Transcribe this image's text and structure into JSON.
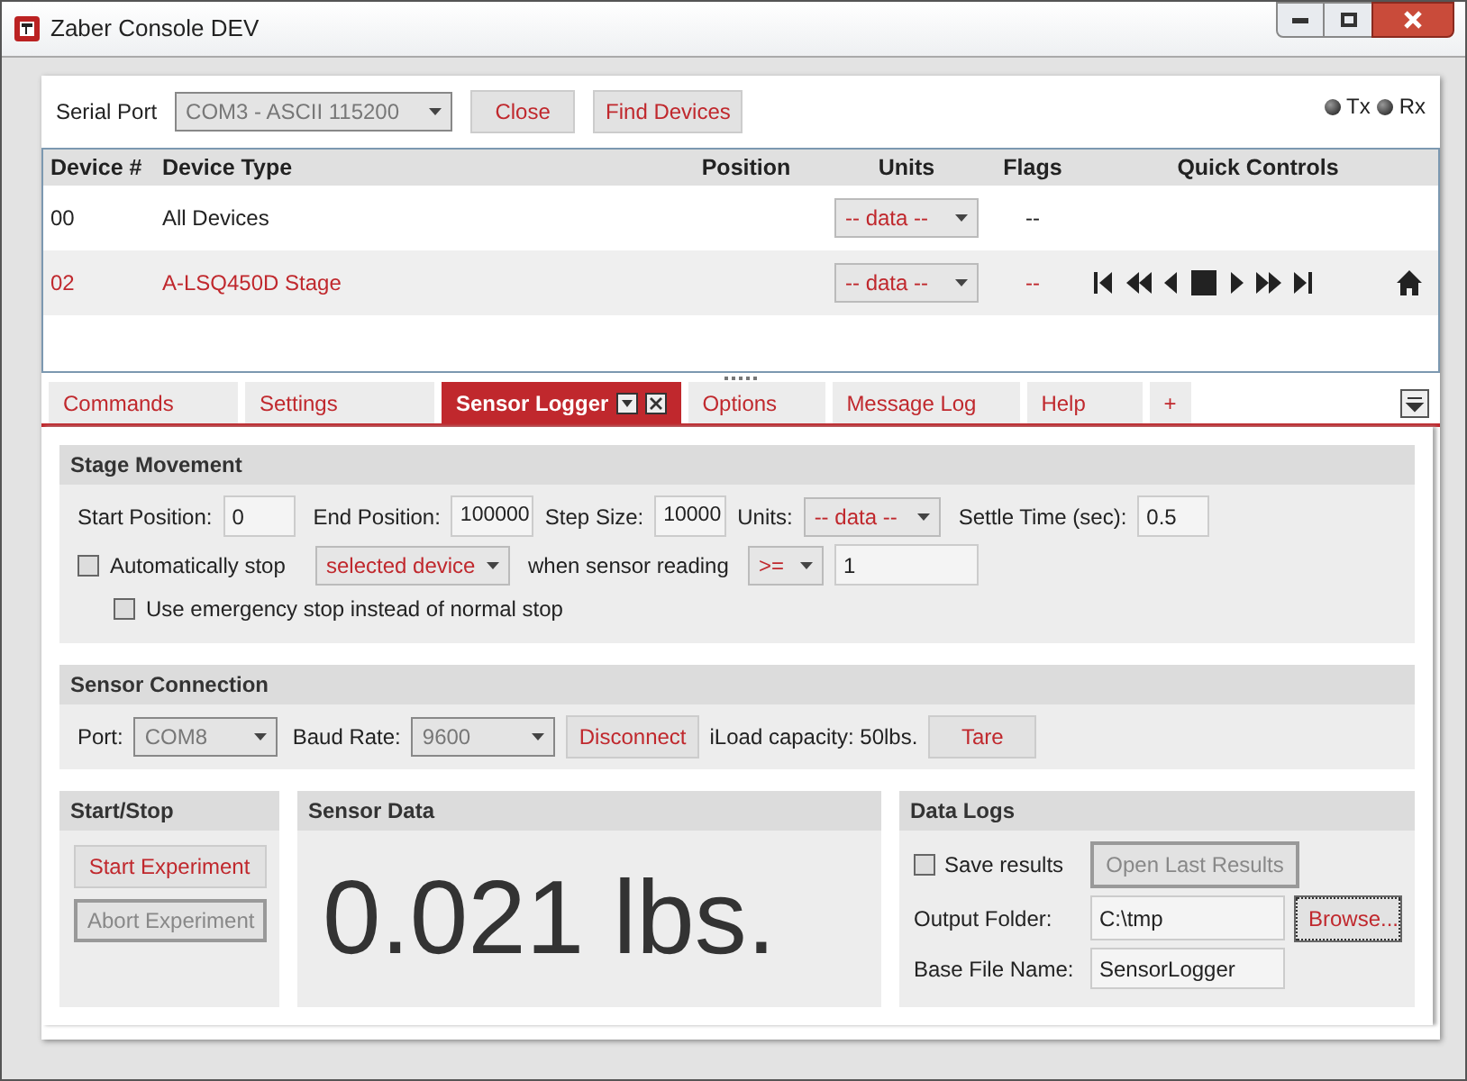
{
  "window": {
    "title": "Zaber Console DEV"
  },
  "connection": {
    "label": "Serial Port",
    "port": "COM3 - ASCII 115200",
    "close": "Close",
    "find": "Find Devices",
    "indicators": [
      {
        "label": "Tx"
      },
      {
        "label": "Rx"
      }
    ]
  },
  "table": {
    "columns": [
      "Device #",
      "Device Type",
      "Position",
      "Units",
      "Flags",
      "Quick Controls"
    ],
    "rows": [
      {
        "device": "00",
        "type": "All Devices",
        "units": "-- data --",
        "flags": "--",
        "selected": false,
        "kind": "group"
      },
      {
        "device": "02",
        "type": "A-LSQ450D Stage",
        "units": "-- data --",
        "flags": "--",
        "selected": true,
        "kind": "device"
      }
    ]
  },
  "tabs": [
    {
      "label": "Commands",
      "selected": false
    },
    {
      "label": "Settings",
      "selected": false
    },
    {
      "label": "Sensor Logger",
      "selected": true
    },
    {
      "label": "Options",
      "selected": false
    },
    {
      "label": "Message Log",
      "selected": false
    },
    {
      "label": "Help",
      "selected": false
    },
    {
      "label": "+",
      "selected": false
    }
  ],
  "stage_movement": {
    "title": "Stage Movement",
    "start_label": "Start Position:",
    "start": "0",
    "end_label": "End Position:",
    "end": "100000",
    "step_label": "Step Size:",
    "step": "10000",
    "units_label": "Units:",
    "units": "-- data --",
    "settle_label": "Settle Time (sec):",
    "settle": "0.5",
    "auto_stop": {
      "label": "Automatically stop",
      "checked": false,
      "target": "selected device",
      "when": "when sensor reading",
      "op": ">=",
      "value": "1"
    },
    "emergency": {
      "label": "Use emergency stop instead of normal stop",
      "checked": false
    }
  },
  "sensor_connection": {
    "title": "Sensor Connection",
    "port_label": "Port:",
    "port": "COM8",
    "baud_label": "Baud Rate:",
    "baud": "9600",
    "disconnect": "Disconnect",
    "capacity": "iLoad capacity: 50lbs.",
    "tare": "Tare"
  },
  "start_stop": {
    "title": "Start/Stop",
    "buttons": [
      {
        "label": "Start Experiment",
        "disabled": false
      },
      {
        "label": "Abort Experiment",
        "disabled": true
      }
    ]
  },
  "sensor_data": {
    "title": "Sensor Data",
    "reading": "0.021 lbs."
  },
  "data_logs": {
    "title": "Data Logs",
    "save": {
      "label": "Save results",
      "checked": false
    },
    "open_last": "Open Last Results",
    "folder_label": "Output Folder:",
    "folder": "C:\\tmp",
    "browse": "Browse...",
    "base_label": "Base File Name:",
    "base": "SensorLogger"
  }
}
